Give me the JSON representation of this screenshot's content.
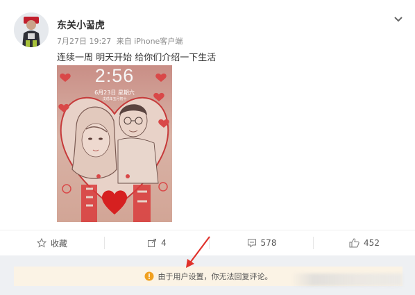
{
  "post": {
    "username": "东关小꿃虎",
    "date": "7月27日 19:27",
    "source": "来自 iPhone客户端",
    "text": "连续一周 明天开始 给你们介绍一下生活"
  },
  "photo": {
    "lock_time": "2:56",
    "lock_date": "6月23日 星期六",
    "lock_lunar": "戊戌年五月初十"
  },
  "actions": {
    "favorite_label": "收藏",
    "repost_count": "4",
    "comment_count": "578",
    "like_count": "452"
  },
  "notice": {
    "text": "由于用户设置，你无法回复评论。"
  },
  "colors": {
    "notice_bg": "#fbf3e5",
    "notice_icon": "#f0a020",
    "arrow": "#e0312b"
  }
}
